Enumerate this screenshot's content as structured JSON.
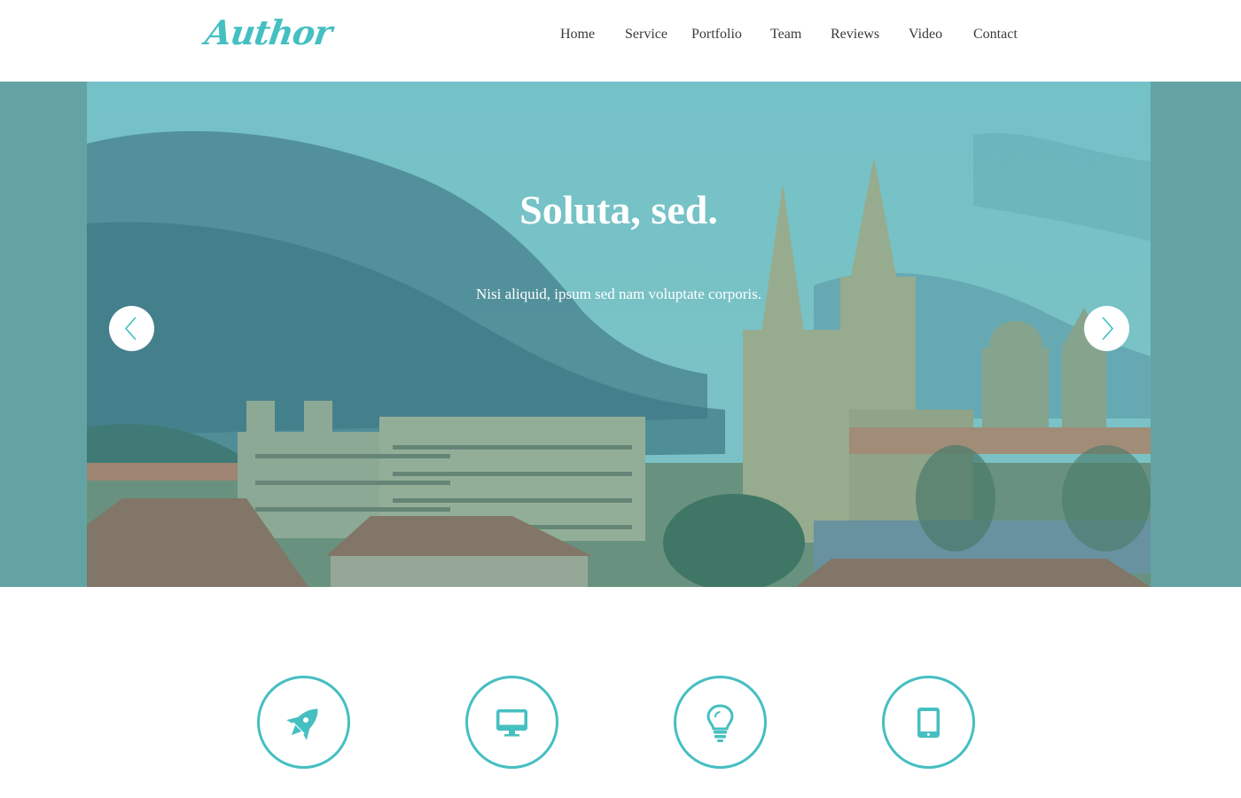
{
  "brand": {
    "logo_text": "Author",
    "accent_color": "#45bfc1"
  },
  "nav": {
    "items": [
      {
        "label": "Home"
      },
      {
        "label": "Service"
      },
      {
        "label": "Portfolio"
      },
      {
        "label": "Team"
      },
      {
        "label": "Reviews"
      },
      {
        "label": "Video"
      },
      {
        "label": "Contact"
      }
    ]
  },
  "hero": {
    "title": "Soluta, sed.",
    "subtitle": "Nisi aliquid, ipsum sed nam voluptate corporis.",
    "overlay_color": "#63a3a3",
    "prev_icon": "chevron-left-icon",
    "next_icon": "chevron-right-icon"
  },
  "services": {
    "icons": [
      "rocket-icon",
      "monitor-icon",
      "lightbulb-icon",
      "tablet-icon"
    ]
  }
}
